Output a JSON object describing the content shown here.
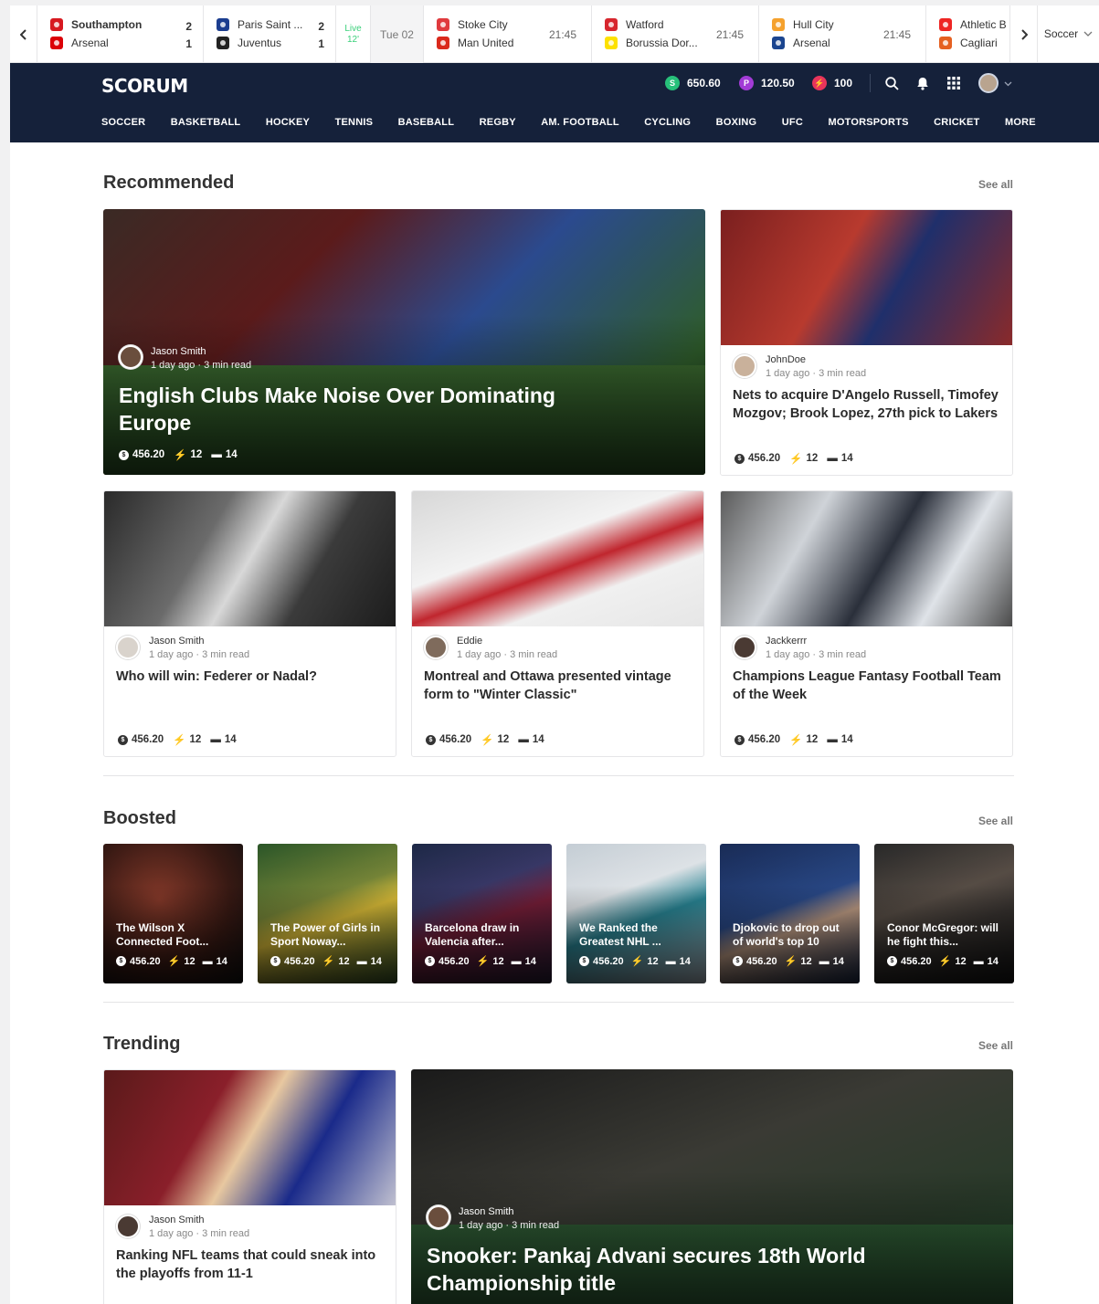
{
  "ticker": {
    "matches": [
      {
        "home": "Southampton",
        "away": "Arsenal",
        "home_score": "2",
        "away_score": "1",
        "home_color": "#d71920",
        "away_color": "#db0007"
      },
      {
        "home": "Paris Saint ...",
        "away": "Juventus",
        "home_score": "2",
        "away_score": "1",
        "home_color": "#1b3d8f",
        "away_color": "#222222"
      },
      {
        "home": "Stoke City",
        "away": "Man United",
        "time": "21:45",
        "home_color": "#e03a3e",
        "away_color": "#da291c"
      },
      {
        "home": "Watford",
        "away": "Borussia Dor...",
        "time": "21:45",
        "home_color": "#d7262e",
        "away_color": "#fde100"
      },
      {
        "home": "Hull City",
        "away": "Arsenal",
        "time": "21:45",
        "home_color": "#f5a12d",
        "away_color": "#1b458f"
      },
      {
        "home": "Athletic B",
        "away": "Cagliari",
        "home_color": "#ee2523",
        "away_color": "#e56021"
      }
    ],
    "live_label": "Live",
    "live_minute": "12'",
    "date_label": "Tue 02",
    "sport_select": "Soccer"
  },
  "header": {
    "logo": "SCORUM",
    "balances": [
      {
        "symbol": "S",
        "value": "650.60",
        "color": "#27c07a"
      },
      {
        "symbol": "P",
        "value": "120.50",
        "color": "#a23bd6"
      },
      {
        "symbol": "⚡",
        "value": "100",
        "color": "#e8345b"
      }
    ],
    "nav": [
      "SOCCER",
      "BASKETBALL",
      "HOCKEY",
      "TENNIS",
      "BASEBALL",
      "REGBY",
      "AM. FOOTBALL",
      "CYCLING",
      "BOXING",
      "UFC",
      "MOTORSPORTS",
      "CRICKET",
      "MORE"
    ]
  },
  "recommended": {
    "title": "Recommended",
    "see_all": "See all",
    "featured": {
      "author": "Jason Smith",
      "time": "1 day ago · 3 min read",
      "title": "English Clubs Make Noise Over Dominating Europe",
      "value": "456.20",
      "votes": "12",
      "comments": "14"
    },
    "side": {
      "author": "JohnDoe",
      "time": "1 day ago · 3 min read",
      "title": "Nets to acquire D'Angelo Russell, Timofey Mozgov; Brook Lopez, 27th pick to Lakers",
      "value": "456.20",
      "votes": "12",
      "comments": "14"
    },
    "row": [
      {
        "author": "Jason Smith",
        "time": "1 day ago · 3 min read",
        "title": "Who will win: Federer or Nadal?",
        "value": "456.20",
        "votes": "12",
        "comments": "14"
      },
      {
        "author": "Eddie",
        "time": "1 day ago · 3 min read",
        "title": "Montreal and Ottawa presented vintage form to \"Winter Classic\"",
        "value": "456.20",
        "votes": "12",
        "comments": "14"
      },
      {
        "author": "Jackkerrr",
        "time": "1 day ago · 3 min read",
        "title": "Champions League Fantasy Football Team of the Week",
        "value": "456.20",
        "votes": "12",
        "comments": "14"
      }
    ]
  },
  "boosted": {
    "title": "Boosted",
    "see_all": "See all",
    "items": [
      {
        "title": "The Wilson X Connected Foot...",
        "value": "456.20",
        "votes": "12",
        "comments": "14"
      },
      {
        "title": "The Power of Girls in Sport Noway...",
        "value": "456.20",
        "votes": "12",
        "comments": "14"
      },
      {
        "title": "Barcelona draw in Valencia after...",
        "value": "456.20",
        "votes": "12",
        "comments": "14"
      },
      {
        "title": "We Ranked the Greatest NHL ...",
        "value": "456.20",
        "votes": "12",
        "comments": "14"
      },
      {
        "title": "Djokovic to drop out of world's top 10",
        "value": "456.20",
        "votes": "12",
        "comments": "14"
      },
      {
        "title": "Conor McGregor: will he fight this...",
        "value": "456.20",
        "votes": "12",
        "comments": "14"
      }
    ]
  },
  "trending": {
    "title": "Trending",
    "see_all": "See all",
    "left": {
      "author": "Jason Smith",
      "time": "1 day ago · 3 min read",
      "title": "Ranking NFL teams that could sneak into the playoffs from 11-1"
    },
    "featured": {
      "author": "Jason Smith",
      "time": "1 day ago · 3 min read",
      "title": "Snooker: Pankaj Advani secures 18th World Championship title"
    }
  }
}
